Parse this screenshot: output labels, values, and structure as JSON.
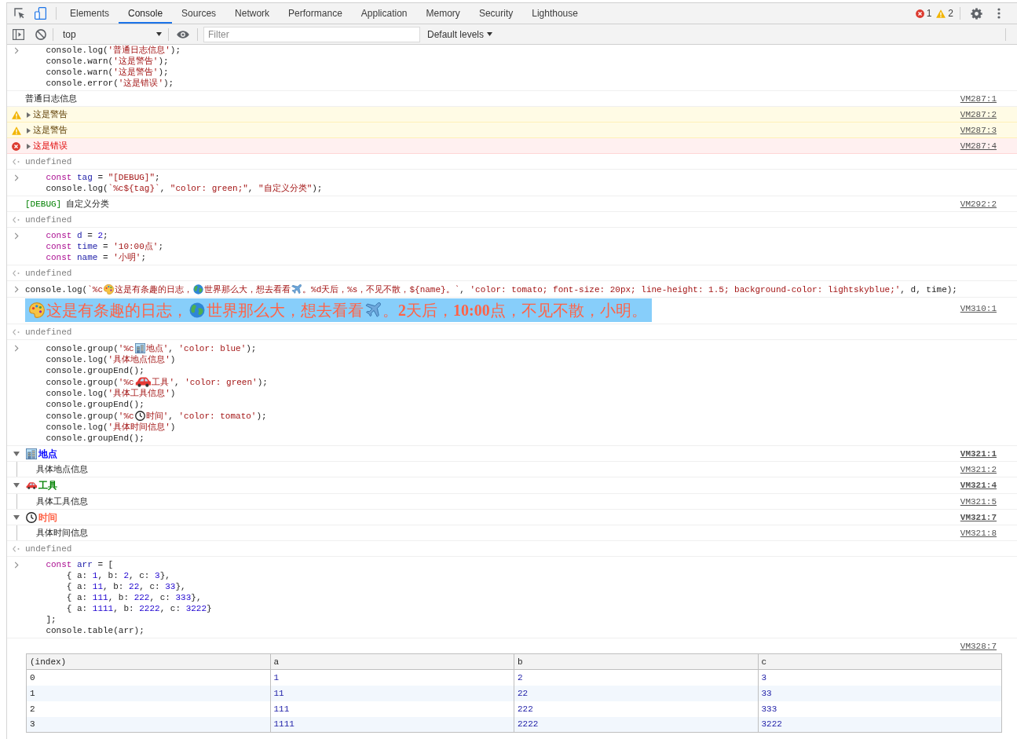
{
  "toolbar": {
    "tabs": [
      {
        "label": "Elements",
        "selected": false
      },
      {
        "label": "Console",
        "selected": true
      },
      {
        "label": "Sources",
        "selected": false
      },
      {
        "label": "Network",
        "selected": false
      },
      {
        "label": "Performance",
        "selected": false
      },
      {
        "label": "Application",
        "selected": false
      },
      {
        "label": "Memory",
        "selected": false
      },
      {
        "label": "Security",
        "selected": false
      },
      {
        "label": "Lighthouse",
        "selected": false
      }
    ],
    "error_count": "1",
    "warning_count": "2"
  },
  "console_toolbar": {
    "context": "top",
    "filter": {
      "placeholder": "Filter"
    },
    "levels": "Default levels"
  },
  "entries": [
    {
      "kind": "input",
      "lines": [
        [
          {
            "kind": "plain",
            "text": "    console.log("
          },
          {
            "kind": "string",
            "text": "'普通日志信息'"
          },
          {
            "kind": "plain",
            "text": ");"
          }
        ],
        [
          {
            "kind": "plain",
            "text": "    console.warn("
          },
          {
            "kind": "string",
            "text": "'这是警告'"
          },
          {
            "kind": "plain",
            "text": ");"
          }
        ],
        [
          {
            "kind": "plain",
            "text": "    console.warn("
          },
          {
            "kind": "string",
            "text": "'这是警告'"
          },
          {
            "kind": "plain",
            "text": ");"
          }
        ],
        [
          {
            "kind": "plain",
            "text": "    console.error("
          },
          {
            "kind": "string",
            "text": "'这是错误'"
          },
          {
            "kind": "plain",
            "text": ");"
          }
        ]
      ]
    },
    {
      "kind": "log",
      "parts": [
        {
          "text": "普通日志信息"
        }
      ],
      "source": "VM287:1"
    },
    {
      "kind": "warning",
      "expanded": false,
      "message": "这是警告",
      "source": "VM287:2"
    },
    {
      "kind": "warning",
      "expanded": false,
      "message": "这是警告",
      "source": "VM287:3"
    },
    {
      "kind": "error",
      "expanded": false,
      "message": "这是错误",
      "source": "VM287:4"
    },
    {
      "kind": "result",
      "value": "undefined"
    },
    {
      "kind": "input",
      "lines": [
        [
          {
            "kind": "keyword",
            "text": "    const "
          },
          {
            "kind": "variable",
            "text": "tag"
          },
          {
            "kind": "plain",
            "text": " = "
          },
          {
            "kind": "string",
            "text": "\"[DEBUG]\""
          },
          {
            "kind": "plain",
            "text": ";"
          }
        ],
        [
          {
            "kind": "plain",
            "text": "    console.log("
          },
          {
            "kind": "string",
            "text": "`%c${tag}`"
          },
          {
            "kind": "plain",
            "text": ", "
          },
          {
            "kind": "string",
            "text": "\"color: green;\""
          },
          {
            "kind": "plain",
            "text": ", "
          },
          {
            "kind": "string",
            "text": "\"自定义分类\""
          },
          {
            "kind": "plain",
            "text": ");"
          }
        ]
      ]
    },
    {
      "kind": "log",
      "parts": [
        {
          "text": "[DEBUG]",
          "color": "#008000"
        },
        {
          "text": "自定义分类"
        }
      ],
      "source": "VM292:2"
    },
    {
      "kind": "result",
      "value": "undefined"
    },
    {
      "kind": "input",
      "lines": [
        [
          {
            "kind": "keyword",
            "text": "    const "
          },
          {
            "kind": "variable",
            "text": "d"
          },
          {
            "kind": "plain",
            "text": " = "
          },
          {
            "kind": "number",
            "text": "2"
          },
          {
            "kind": "plain",
            "text": ";"
          }
        ],
        [
          {
            "kind": "keyword",
            "text": "    const "
          },
          {
            "kind": "variable",
            "text": "time"
          },
          {
            "kind": "plain",
            "text": " = "
          },
          {
            "kind": "string",
            "text": "'10:00点'"
          },
          {
            "kind": "plain",
            "text": ";"
          }
        ],
        [
          {
            "kind": "keyword",
            "text": "    const "
          },
          {
            "kind": "variable",
            "text": "name"
          },
          {
            "kind": "plain",
            "text": " = "
          },
          {
            "kind": "string",
            "text": "'小明'"
          },
          {
            "kind": "plain",
            "text": ";"
          }
        ]
      ]
    },
    {
      "kind": "result",
      "value": "undefined"
    },
    {
      "kind": "input",
      "lines": [
        [
          {
            "kind": "plain",
            "text": "console.log("
          },
          {
            "kind": "string",
            "text": "`%c"
          },
          {
            "kind": "palette"
          },
          {
            "kind": "string",
            "text": "这是有条趣的日志，"
          },
          {
            "kind": "globe"
          },
          {
            "kind": "string",
            "text": "世界那么大，想去看看"
          },
          {
            "kind": "airplane"
          },
          {
            "kind": "string",
            "text": "。%d天后，%s，不见不散，${name}。`"
          },
          {
            "kind": "plain",
            "text": ", "
          },
          {
            "kind": "string",
            "text": "'color: tomato; font-size: 20px; line-height: 1.5; background-color: lightskyblue;'"
          },
          {
            "kind": "plain",
            "text": ", d, time);"
          }
        ]
      ]
    },
    {
      "kind": "styled",
      "parts": [
        {
          "kind": "palette"
        },
        {
          "kind": "text",
          "text": "这是有条趣的日志，"
        },
        {
          "kind": "globe"
        },
        {
          "kind": "text",
          "text": "世界那么大，想去看看"
        },
        {
          "kind": "airplane"
        },
        {
          "kind": "text",
          "text": "。**2**天后，**10:00**点，不见不散，小明。"
        }
      ],
      "source": "VM310:1"
    },
    {
      "kind": "result",
      "value": "undefined"
    },
    {
      "kind": "input",
      "lines": [
        [
          {
            "kind": "plain",
            "text": "    console.group("
          },
          {
            "kind": "string",
            "text": "'%c"
          },
          {
            "kind": "building"
          },
          {
            "kind": "string",
            "text": "地点'"
          },
          {
            "kind": "plain",
            "text": ", "
          },
          {
            "kind": "string",
            "text": "'color: blue'"
          },
          {
            "kind": "plain",
            "text": ");"
          }
        ],
        [
          {
            "kind": "plain",
            "text": "    console.log("
          },
          {
            "kind": "string",
            "text": "'具体地点信息'"
          },
          {
            "kind": "plain",
            "text": ")"
          }
        ],
        [
          {
            "kind": "plain",
            "text": "    console.groupEnd();"
          }
        ],
        [
          {
            "kind": "plain",
            "text": "    console.group("
          },
          {
            "kind": "string",
            "text": "'%c"
          },
          {
            "kind": "car"
          },
          {
            "kind": "string",
            "text": "工具'"
          },
          {
            "kind": "plain",
            "text": ", "
          },
          {
            "kind": "string",
            "text": "'color: green'"
          },
          {
            "kind": "plain",
            "text": ");"
          }
        ],
        [
          {
            "kind": "plain",
            "text": "    console.log("
          },
          {
            "kind": "string",
            "text": "'具体工具信息'"
          },
          {
            "kind": "plain",
            "text": ")"
          }
        ],
        [
          {
            "kind": "plain",
            "text": "    console.groupEnd();"
          }
        ],
        [
          {
            "kind": "plain",
            "text": "    console.group("
          },
          {
            "kind": "string",
            "text": "'%c"
          },
          {
            "kind": "clock"
          },
          {
            "kind": "string",
            "text": "时间'"
          },
          {
            "kind": "plain",
            "text": ", "
          },
          {
            "kind": "string",
            "text": "'color: tomato'"
          },
          {
            "kind": "plain",
            "text": ");"
          }
        ],
        [
          {
            "kind": "plain",
            "text": "    console.log("
          },
          {
            "kind": "string",
            "text": "'具体时间信息'"
          },
          {
            "kind": "plain",
            "text": ")"
          }
        ],
        [
          {
            "kind": "plain",
            "text": "    console.groupEnd();"
          }
        ]
      ]
    },
    {
      "kind": "group",
      "expanded": true,
      "emoji": {
        "kind": "building"
      },
      "label": "地点",
      "color": "#0000ff",
      "source": "VM321:1",
      "children": [
        {
          "kind": "log",
          "parts": [
            {
              "text": "具体地点信息"
            }
          ],
          "source": "VM321:2"
        }
      ]
    },
    {
      "kind": "group",
      "expanded": true,
      "emoji": {
        "kind": "car"
      },
      "label": "工具",
      "color": "#008000",
      "source": "VM321:4",
      "children": [
        {
          "kind": "log",
          "parts": [
            {
              "text": "具体工具信息"
            }
          ],
          "source": "VM321:5"
        }
      ]
    },
    {
      "kind": "group",
      "expanded": true,
      "emoji": {
        "kind": "clock"
      },
      "label": "时间",
      "color": "#ff6347",
      "source": "VM321:7",
      "children": [
        {
          "kind": "log",
          "parts": [
            {
              "text": "具体时间信息"
            }
          ],
          "source": "VM321:8"
        }
      ]
    },
    {
      "kind": "result",
      "value": "undefined"
    },
    {
      "kind": "input",
      "lines": [
        [
          {
            "kind": "keyword",
            "text": "    const "
          },
          {
            "kind": "variable",
            "text": "arr"
          },
          {
            "kind": "plain",
            "text": " = ["
          }
        ],
        [
          {
            "kind": "plain",
            "text": "        { a: "
          },
          {
            "kind": "number",
            "text": "1"
          },
          {
            "kind": "plain",
            "text": ", b: "
          },
          {
            "kind": "number",
            "text": "2"
          },
          {
            "kind": "plain",
            "text": ", c: "
          },
          {
            "kind": "number",
            "text": "3"
          },
          {
            "kind": "plain",
            "text": "},"
          }
        ],
        [
          {
            "kind": "plain",
            "text": "        { a: "
          },
          {
            "kind": "number",
            "text": "11"
          },
          {
            "kind": "plain",
            "text": ", b: "
          },
          {
            "kind": "number",
            "text": "22"
          },
          {
            "kind": "plain",
            "text": ", c: "
          },
          {
            "kind": "number",
            "text": "33"
          },
          {
            "kind": "plain",
            "text": "},"
          }
        ],
        [
          {
            "kind": "plain",
            "text": "        { a: "
          },
          {
            "kind": "number",
            "text": "111"
          },
          {
            "kind": "plain",
            "text": ", b: "
          },
          {
            "kind": "number",
            "text": "222"
          },
          {
            "kind": "plain",
            "text": ", c: "
          },
          {
            "kind": "number",
            "text": "333"
          },
          {
            "kind": "plain",
            "text": "},"
          }
        ],
        [
          {
            "kind": "plain",
            "text": "        { a: "
          },
          {
            "kind": "number",
            "text": "1111"
          },
          {
            "kind": "plain",
            "text": ", b: "
          },
          {
            "kind": "number",
            "text": "2222"
          },
          {
            "kind": "plain",
            "text": ", c: "
          },
          {
            "kind": "number",
            "text": "3222"
          },
          {
            "kind": "plain",
            "text": "}"
          }
        ],
        [
          {
            "kind": "plain",
            "text": "    ];"
          }
        ],
        [
          {
            "kind": "plain",
            "text": "    console.table(arr);"
          }
        ]
      ]
    },
    {
      "kind": "table",
      "source": "VM328:7",
      "table": {
        "columns": [
          "(index)",
          "a",
          "b",
          "c"
        ],
        "rows": [
          [
            "0",
            "1",
            "2",
            "3"
          ],
          [
            "1",
            "11",
            "22",
            "33"
          ],
          [
            "2",
            "111",
            "222",
            "333"
          ],
          [
            "3",
            "1111",
            "2222",
            "3222"
          ]
        ]
      }
    }
  ]
}
